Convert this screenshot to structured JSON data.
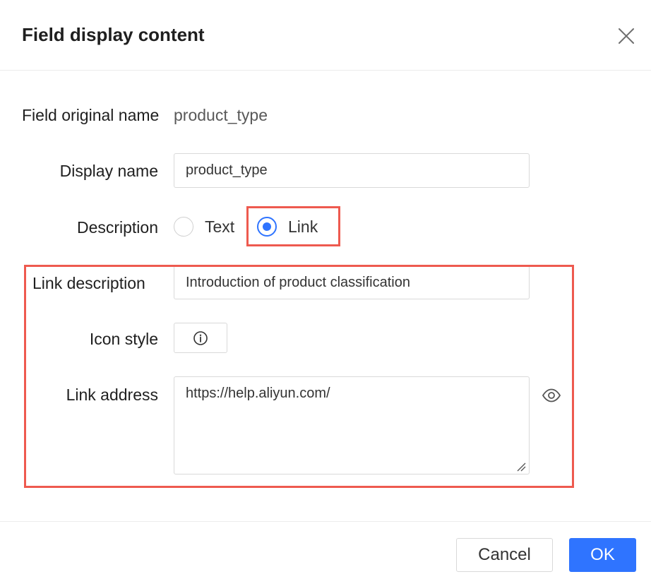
{
  "dialog": {
    "title": "Field display content"
  },
  "form": {
    "original_name_label": "Field original name",
    "original_name_value": "product_type",
    "display_name_label": "Display name",
    "display_name_value": "product_type",
    "description_label": "Description",
    "description_options": [
      {
        "label": "Text",
        "checked": false
      },
      {
        "label": "Link",
        "checked": true
      }
    ],
    "link_description_label": "Link description",
    "link_description_value": "Introduction of product classification",
    "icon_style_label": "Icon style",
    "icon_style_icon": "info-circle-icon",
    "link_address_label": "Link address",
    "link_address_value": "https://help.aliyun.com/"
  },
  "footer": {
    "cancel_label": "Cancel",
    "ok_label": "OK"
  },
  "colors": {
    "primary": "#2f74ff",
    "highlight": "#ee5a4f"
  }
}
